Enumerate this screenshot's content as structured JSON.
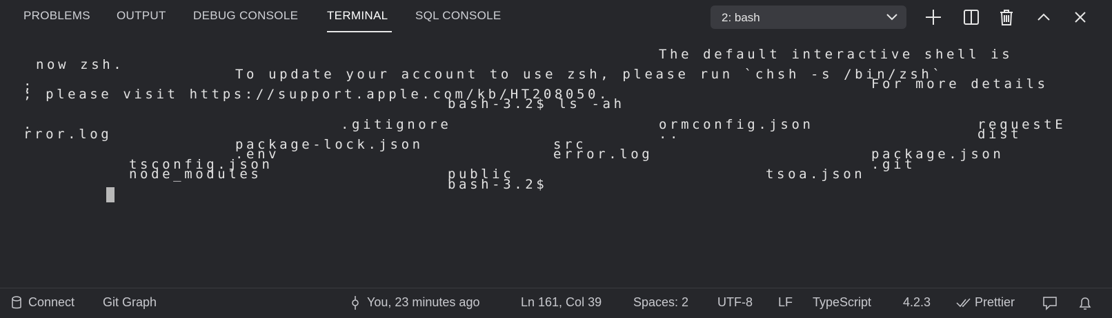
{
  "tabs": [
    {
      "label": "PROBLEMS"
    },
    {
      "label": "OUTPUT"
    },
    {
      "label": "DEBUG CONSOLE"
    },
    {
      "label": "TERMINAL"
    },
    {
      "label": "SQL CONSOLE"
    }
  ],
  "active_tab": "TERMINAL",
  "terminal_select": {
    "value": "2: bash"
  },
  "toolbar_icons": [
    "plus-icon",
    "split-icon",
    "trash-icon",
    "chevron-up-icon",
    "close-icon"
  ],
  "terminal": {
    "lines": [
      "The default interactive shell is",
      "now zsh.",
      "To update your account to use zsh, please run `chsh -s /bin/zsh`",
      "For more details",
      ";",
      "; please visit https://support.apple.com/kb/HT208050.",
      "bash-3.2$ ls -ah",
      ".",
      ".gitignore",
      "ormconfig.json",
      "requestE",
      "rror.log",
      "..",
      "dist",
      "package-lock.json",
      "src",
      ".env",
      "error.log",
      "package.json",
      "tsconfig.json",
      ".git",
      "node_modules",
      "public",
      "tsoa.json",
      "bash-3.2$"
    ]
  },
  "statusbar": {
    "connect": "Connect",
    "git_graph": "Git Graph",
    "blame": "You, 23 minutes ago",
    "position": "Ln 161, Col 39",
    "spaces": "Spaces: 2",
    "encoding": "UTF-8",
    "eol": "LF",
    "language": "TypeScript",
    "version": "4.2.3",
    "prettier": "Prettier"
  },
  "colors": {
    "background": "#26272b",
    "text": "#e3e3e3",
    "select_bg": "#3a3b40"
  }
}
